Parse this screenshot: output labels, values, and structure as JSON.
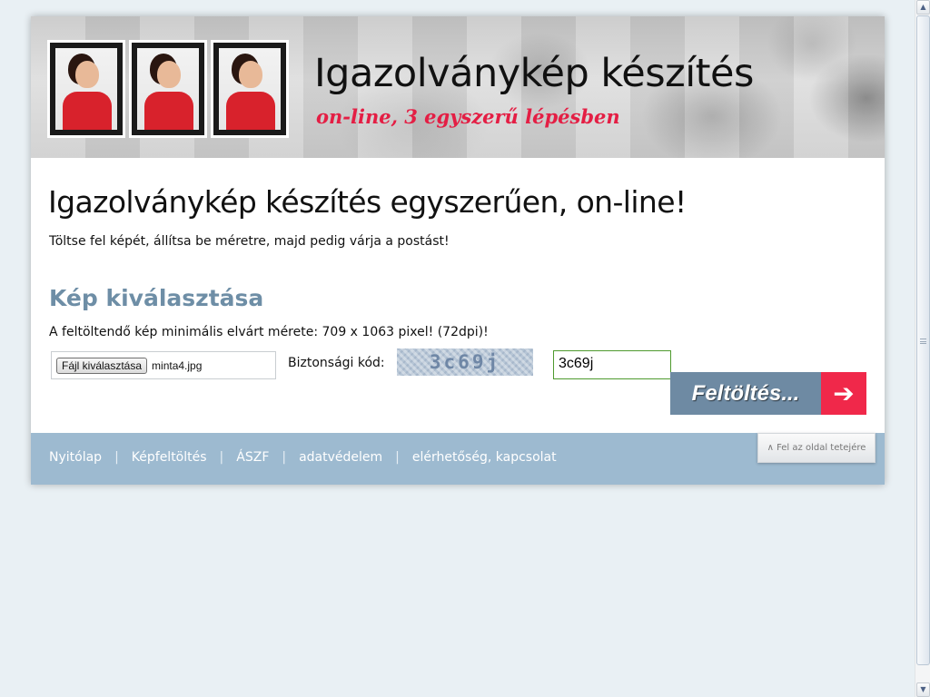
{
  "header": {
    "title": "Igazolványkép készítés",
    "subtitle": "on-line, 3 egyszerű lépésben"
  },
  "main": {
    "heading": "Igazolványkép készítés egyszerűen, on-line!",
    "lead": "Töltse fel képét, állítsa be méretre, majd pedig várja a postást!",
    "section_title": "Kép kiválasztása",
    "min_size_text": "A feltöltendő kép minimális elvárt mérete: 709 x 1063 pixel! (72dpi)!",
    "file_button_label": "Fájl kiválasztása",
    "file_name": "minta4.jpg",
    "security_label": "Biztonsági kód:",
    "captcha_text": "3c69j",
    "code_value": "3c69j",
    "upload_label": "Feltöltés...",
    "upload_arrow": "➔"
  },
  "footer": {
    "nav": [
      "Nyitólap",
      "Képfeltöltés",
      "ÁSZF",
      "adatvédelem",
      "elérhetőség, kapcsolat"
    ],
    "separator": "|",
    "to_top": "∧ Fel az oldal tetejére"
  },
  "colors": {
    "accent": "#e41e44",
    "section_title": "#6e8ea6",
    "footer_bg": "#9dbad0",
    "upload_bg": "#6e8aa3",
    "upload_arrow_bg": "#f0284a",
    "page_bg": "#e9f0f4"
  },
  "icons": {
    "scroll_up": "scroll-up-arrow-icon",
    "scroll_down": "scroll-down-arrow-icon",
    "upload_arrow": "right-arrow-icon"
  }
}
